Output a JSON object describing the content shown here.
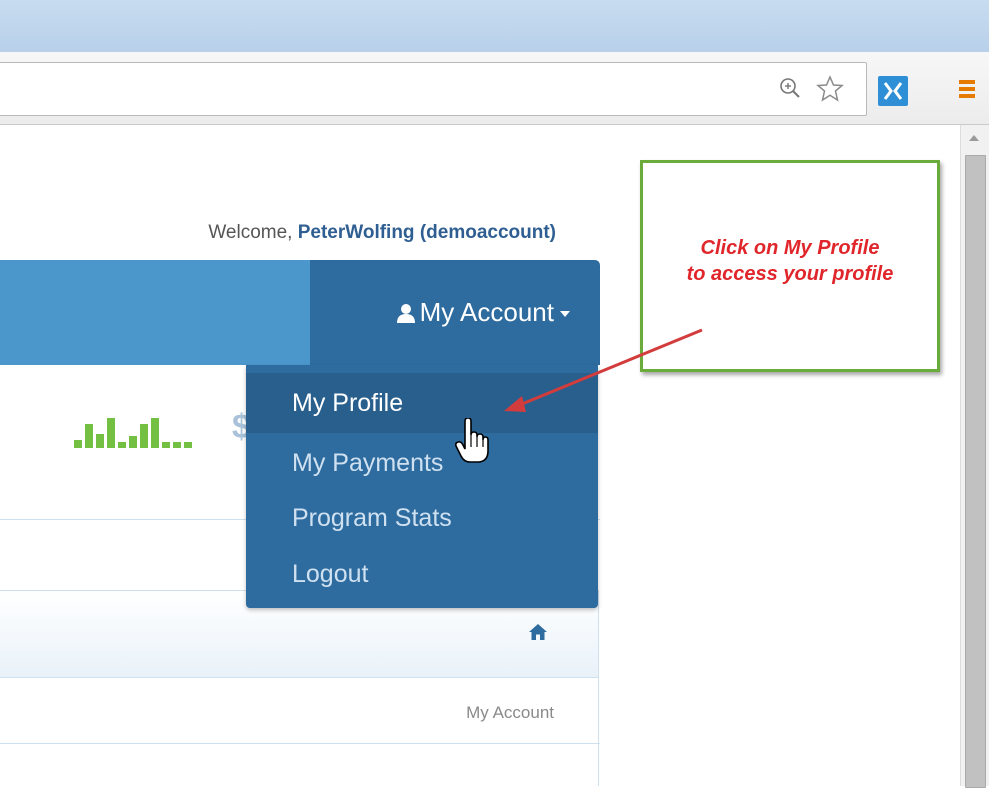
{
  "header": {
    "welcome_prefix": "Welcome, ",
    "welcome_user": "PeterWolfing (demoaccount)"
  },
  "navbar": {
    "account_label": "My Account",
    "account_icon": "user-icon"
  },
  "dropdown": {
    "items": [
      {
        "label": "My Profile"
      },
      {
        "label": "My Payments"
      },
      {
        "label": "Program Stats"
      },
      {
        "label": "Logout"
      }
    ]
  },
  "content": {
    "dollar_partial": "$",
    "breadcrumb": "My Account"
  },
  "annotation": {
    "line1": "Click on My Profile",
    "line2": "to access your profile"
  },
  "colors": {
    "nav_blue": "#2e6c9f",
    "nav_light": "#4b97cc",
    "callout_border": "#6aab3c",
    "callout_text": "#e0262b"
  }
}
